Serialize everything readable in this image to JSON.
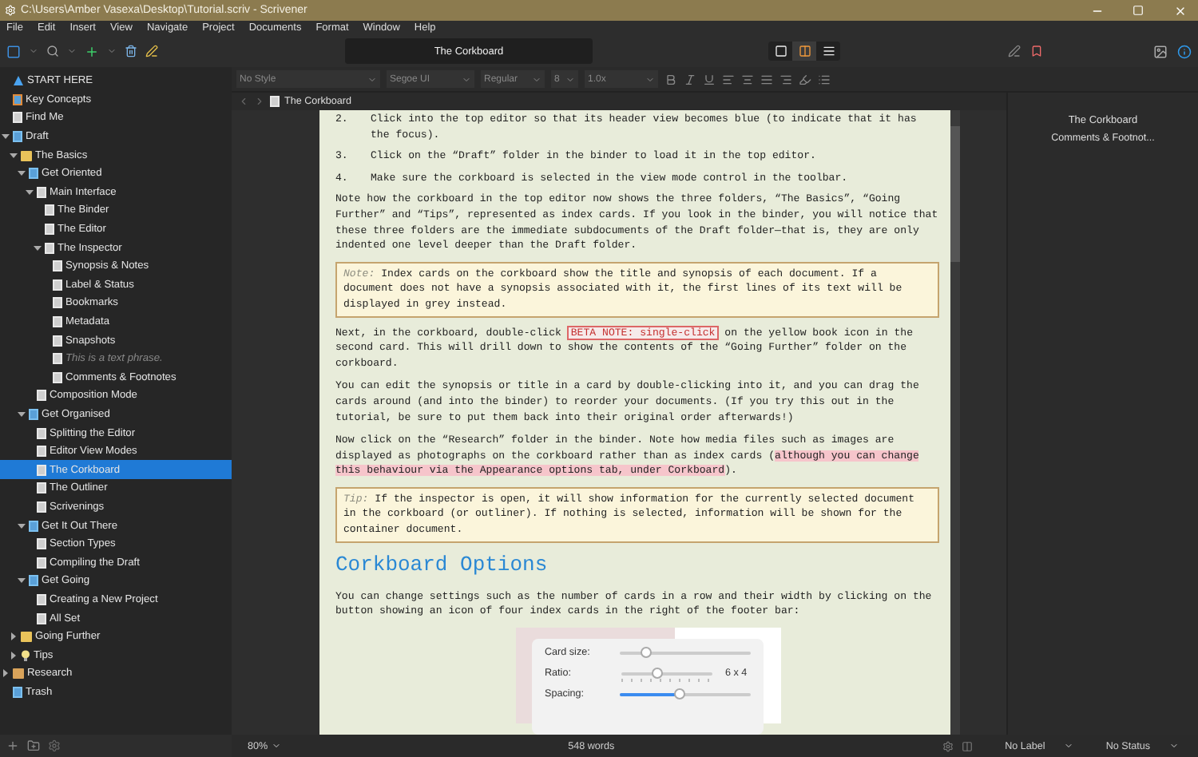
{
  "window": {
    "title": "C:\\Users\\Amber Vasexa\\Desktop\\Tutorial.scriv - Scrivener"
  },
  "menu": [
    "File",
    "Edit",
    "Insert",
    "View",
    "Navigate",
    "Project",
    "Documents",
    "Format",
    "Window",
    "Help"
  ],
  "toolbar": {
    "title": "The Corkboard",
    "view_modes": [
      {
        "kind": "document",
        "selected": false
      },
      {
        "kind": "corkboard",
        "selected": true
      },
      {
        "kind": "outliner",
        "selected": false
      }
    ]
  },
  "format_bar": {
    "style": "No Style",
    "font": "Segoe UI",
    "weight": "Regular",
    "size": "8",
    "spacing": "1.0x"
  },
  "binder": {
    "items": [
      {
        "label": "START HERE",
        "kind": "start",
        "selected": false
      },
      {
        "label": "Key Concepts",
        "kind": "book",
        "selected": false
      },
      {
        "label": "Find Me",
        "kind": "doc",
        "selected": false
      },
      {
        "label": "Draft",
        "kind": "draft",
        "selected": false,
        "expanded": true,
        "children": [
          {
            "label": "The Basics",
            "kind": "folder",
            "selected": false,
            "expanded": true,
            "children": [
              {
                "label": "Get Oriented",
                "kind": "docs",
                "selected": false,
                "expanded": true,
                "children": [
                  {
                    "label": "Main Interface",
                    "kind": "doc",
                    "selected": false,
                    "expanded": true,
                    "children": [
                      {
                        "label": "The Binder",
                        "kind": "doc",
                        "selected": false
                      },
                      {
                        "label": "The Editor",
                        "kind": "doc",
                        "selected": false
                      },
                      {
                        "label": "The Inspector",
                        "kind": "doc",
                        "selected": false,
                        "expanded": true,
                        "children": [
                          {
                            "label": "Synopsis & Notes",
                            "kind": "doc",
                            "selected": false
                          },
                          {
                            "label": "Label & Status",
                            "kind": "doc",
                            "selected": false
                          },
                          {
                            "label": "Bookmarks",
                            "kind": "doc",
                            "selected": false
                          },
                          {
                            "label": "Metadata",
                            "kind": "doc",
                            "selected": false
                          },
                          {
                            "label": "Snapshots",
                            "kind": "doc",
                            "selected": false
                          },
                          {
                            "label": "This is a text phrase.",
                            "kind": "phrase",
                            "selected": false
                          },
                          {
                            "label": "Comments & Footnotes",
                            "kind": "doc",
                            "selected": false
                          }
                        ]
                      }
                    ]
                  },
                  {
                    "label": "Composition Mode",
                    "kind": "doc",
                    "selected": false
                  }
                ]
              },
              {
                "label": "Get Organised",
                "kind": "docs",
                "selected": false,
                "expanded": true,
                "children": [
                  {
                    "label": "Splitting the Editor",
                    "kind": "doc",
                    "selected": false
                  },
                  {
                    "label": "Editor View Modes",
                    "kind": "doc",
                    "selected": false
                  },
                  {
                    "label": "The Corkboard",
                    "kind": "doc",
                    "selected": true
                  },
                  {
                    "label": "The Outliner",
                    "kind": "doc",
                    "selected": false
                  },
                  {
                    "label": "Scrivenings",
                    "kind": "doc",
                    "selected": false
                  }
                ]
              },
              {
                "label": "Get It Out There",
                "kind": "docs",
                "selected": false,
                "expanded": true,
                "children": [
                  {
                    "label": "Section Types",
                    "kind": "doc",
                    "selected": false
                  },
                  {
                    "label": "Compiling the Draft",
                    "kind": "doc",
                    "selected": false
                  }
                ]
              },
              {
                "label": "Get Going",
                "kind": "docs",
                "selected": false,
                "expanded": true,
                "children": [
                  {
                    "label": "Creating a New Project",
                    "kind": "doc",
                    "selected": false
                  },
                  {
                    "label": "All Set",
                    "kind": "doc",
                    "selected": false
                  }
                ]
              }
            ]
          },
          {
            "label": "Going Further",
            "kind": "folder",
            "selected": false,
            "expanded": false
          },
          {
            "label": "Tips",
            "kind": "tips",
            "selected": false,
            "expanded": false
          }
        ]
      },
      {
        "label": "Research",
        "kind": "research",
        "selected": false,
        "expanded": false
      },
      {
        "label": "Trash",
        "kind": "trash",
        "selected": false
      }
    ]
  },
  "editor": {
    "title": "The Corkboard",
    "blocks": [
      {
        "kind": "list_item",
        "number": "2.",
        "text": "Click into the top editor so that its header view becomes blue (to indicate that it has the focus)."
      },
      {
        "kind": "list_item",
        "number": "3.",
        "text": "Click on the “Draft” folder in the binder to load it in the top editor."
      },
      {
        "kind": "list_item",
        "number": "4.",
        "text": "Make sure the corkboard is selected in the view mode control in the toolbar."
      },
      {
        "kind": "paragraph",
        "segments": [
          {
            "kind": "plain",
            "text": "Note how the corkboard in the top editor now shows the three folders, “The Basics”, “Going Further” and “Tips”, represented as index cards. If you look in the binder, you will notice that these three folders are the immediate subdocuments of the Draft folder—that is, they are only indented one level deeper than the Draft folder."
          }
        ]
      },
      {
        "kind": "note",
        "label": "Note:",
        "text": "Index cards on the corkboard show the title and synopsis of each document. If a document does not have a synopsis associated with it, the first lines of its text will be displayed in grey instead."
      },
      {
        "kind": "paragraph",
        "segments": [
          {
            "kind": "plain",
            "text": "Next, in the corkboard, double-click "
          },
          {
            "kind": "inline_note",
            "text": "BETA NOTE: single-click"
          },
          {
            "kind": "plain",
            "text": " on the yellow book icon in the second card. This will drill down to show the contents of the “Going Further” folder on the corkboard."
          }
        ]
      },
      {
        "kind": "paragraph",
        "segments": [
          {
            "kind": "plain",
            "text": "You can edit the synopsis or title in a card by double-clicking into it, and you can drag the cards around (and into the binder) to reorder your documents. (If you try this out in the tutorial, be sure to put them back into their original order afterwards!)"
          }
        ]
      },
      {
        "kind": "paragraph",
        "segments": [
          {
            "kind": "plain",
            "text": "Now click on the “Research” folder in the binder. Note how media files such as images are displayed as photographs on the corkboard rather than as index cards ("
          },
          {
            "kind": "highlight",
            "text": "although you can change this behaviour via the Appearance options tab, under Corkboard"
          },
          {
            "kind": "plain",
            "text": ")."
          }
        ]
      },
      {
        "kind": "note",
        "label": "Tip:",
        "text": "If the inspector is open, it will show information for the currently selected document in the corkboard (or outliner). If nothing is selected, information will be shown for the container document."
      },
      {
        "kind": "heading",
        "text": "Corkboard Options"
      },
      {
        "kind": "paragraph",
        "segments": [
          {
            "kind": "plain",
            "text": "You can change settings such as the number of cards in a row and their width by clicking on the button showing an icon of four index cards in the right of the footer bar:"
          }
        ]
      },
      {
        "kind": "figure",
        "rows": [
          {
            "kind": "plain",
            "label": "Card size:",
            "level": 0.2
          },
          {
            "kind": "ticked",
            "label": "Ratio:",
            "level": 0.38,
            "reading": "6 x 4"
          },
          {
            "kind": "filled",
            "label": "Spacing:",
            "level": 0.45
          }
        ]
      }
    ]
  },
  "inspector": {
    "title": "The Corkboard",
    "section": "Comments & Footnot..."
  },
  "footer": {
    "zoom": "80%",
    "words": "548 words",
    "label": "No Label",
    "status": "No Status"
  }
}
